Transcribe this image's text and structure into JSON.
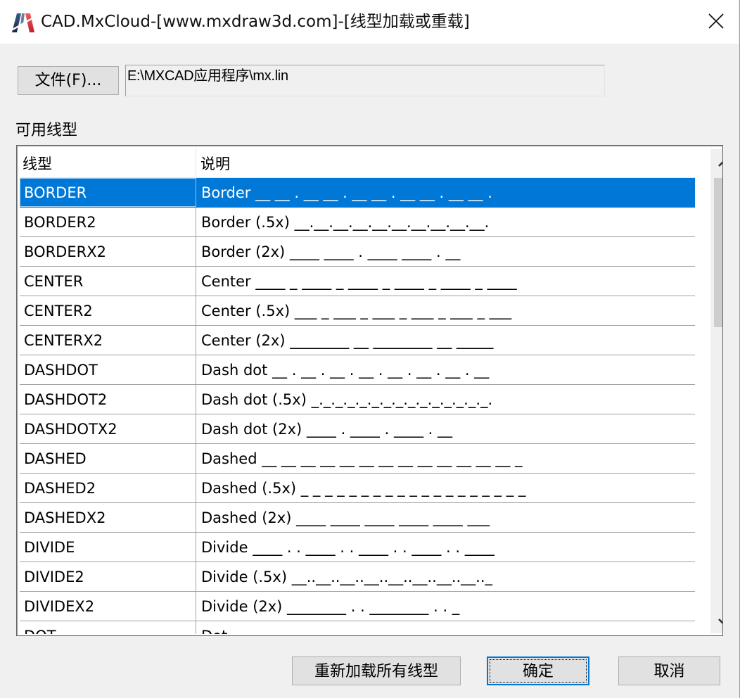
{
  "window": {
    "title": "CAD.MxCloud-[www.mxdraw3d.com]-[线型加载或重载]",
    "app_icon": "mxcad-logo-icon",
    "close_icon": "close-icon"
  },
  "file": {
    "button_label": "文件(F)...",
    "path_value": "E:\\MXCAD应用程序\\mx.lin"
  },
  "linetypes": {
    "group_label": "可用线型",
    "columns": [
      "线型",
      "说明"
    ],
    "selected_index": 0,
    "rows": [
      {
        "name": "BORDER",
        "desc": "Border __ __ . __ __ . __ __ . __ __ . __ __ ."
      },
      {
        "name": "BORDER2",
        "desc": "Border (.5x) __.__.__.__.__.__.__.__.__.__."
      },
      {
        "name": "BORDERX2",
        "desc": "Border (2x) ____  ____   .   ____  ____   .   __"
      },
      {
        "name": "CENTER",
        "desc": "Center ____ _ ____ _ ____ _ ____ _ ____ _ ____"
      },
      {
        "name": "CENTER2",
        "desc": "Center (.5x) ___ _ ___ _ ___ _ ___ _ ___ _ ___"
      },
      {
        "name": "CENTERX2",
        "desc": "Center (2x) ________  __  ________  __  _____"
      },
      {
        "name": "DASHDOT",
        "desc": "Dash dot __ . __ . __ . __ . __ . __ . __ . __"
      },
      {
        "name": "DASHDOT2",
        "desc": "Dash dot (.5x) _._._._._._._._._._._._._._._."
      },
      {
        "name": "DASHDOTX2",
        "desc": "Dash dot (2x) ____  .  ____  .  ____  .  __"
      },
      {
        "name": "DASHED",
        "desc": "Dashed __ __ __ __ __ __ __ __ __ __ __ __ __ _"
      },
      {
        "name": "DASHED2",
        "desc": "Dashed (.5x) _ _ _ _ _ _ _ _ _ _ _ _ _ _ _ _ _ _ _"
      },
      {
        "name": "DASHEDX2",
        "desc": "Dashed (2x) ____  ____  ____  ____  ____  ___"
      },
      {
        "name": "DIVIDE",
        "desc": "Divide ____ . . ____ . . ____ . . ____ . . ____"
      },
      {
        "name": "DIVIDE2",
        "desc": "Divide (.5x) __..__..__..__..__..__..__..__.._"
      },
      {
        "name": "DIVIDEX2",
        "desc": "Divide (2x) ________  .  .  ________  .  .  _"
      },
      {
        "name": "DOT",
        "desc": "Dot . . . . . . . . . . . . . . . . . . . . . . ."
      }
    ]
  },
  "scrollbar": {
    "up_icon": "chevron-up-icon",
    "down_icon": "chevron-down-icon",
    "position_fraction": 0.0
  },
  "buttons": {
    "reload_all": "重新加载所有线型",
    "ok": "确定",
    "cancel": "取消"
  },
  "colors": {
    "selection": "#0078d7",
    "window_bg": "#f0f0f0",
    "button_bg": "#e1e1e1"
  }
}
